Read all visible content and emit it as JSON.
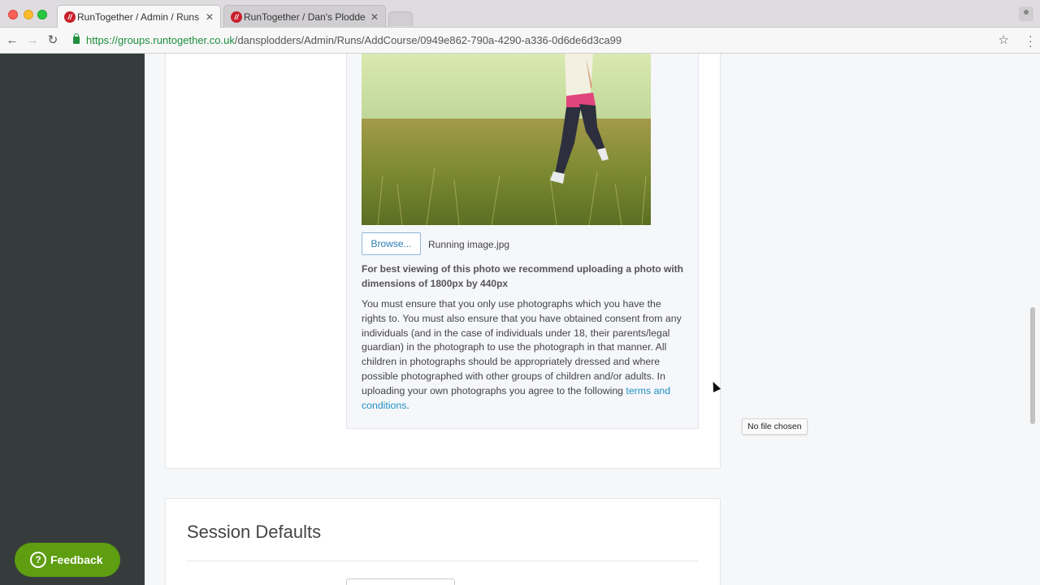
{
  "browser": {
    "tabs": [
      {
        "title": "RunTogether / Admin / Runs / ",
        "active": true
      },
      {
        "title": "RunTogether / Dan's Plodders",
        "active": false
      }
    ],
    "favicon_letter": "//",
    "url_host": "https://groups.runtogether.co.uk",
    "url_path": "/dansplodders/Admin/Runs/AddCourse/0949e862-790a-4290-a336-0d6de6d3ca99"
  },
  "photo_upload": {
    "browse_label": "Browse...",
    "file_name": "Running image.jpg",
    "hint": "For best viewing of this photo we recommend uploading a photo with dimensions of 1800px by 440px",
    "consent_text": "You must ensure that you only use photographs which you have the rights to. You must also ensure that you have obtained consent from any individuals (and in the case of individuals under 18, their parents/legal guardian) in the photograph to use the photograph in that manner. All children in photographs should be appropriately dressed and where possible photographed with other groups of children and/or adults. In uploading your own photographs you agree to the following ",
    "terms_link": "terms and conditions",
    "consent_end": "."
  },
  "session_defaults": {
    "title": "Session Defaults"
  },
  "tooltip": "No file chosen",
  "feedback_label": "Feedback",
  "colors": {
    "sidebar": "#363c3c",
    "feedback": "#5e9e10",
    "link": "#1f8fc0",
    "url_green": "#1e8e3e"
  }
}
